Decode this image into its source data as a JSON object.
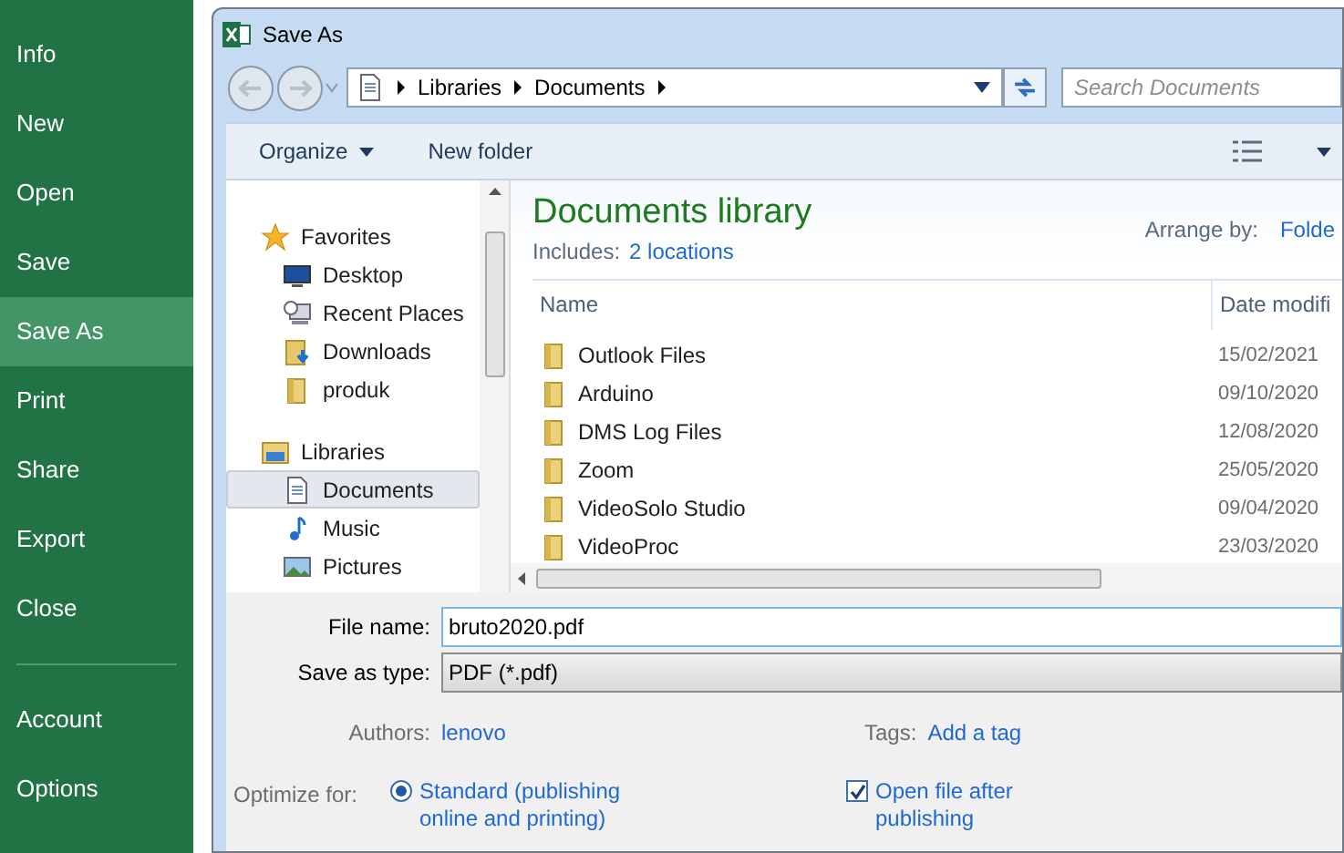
{
  "sidebar": {
    "items": [
      {
        "label": "Info",
        "selected": false
      },
      {
        "label": "New",
        "selected": false
      },
      {
        "label": "Open",
        "selected": false
      },
      {
        "label": "Save",
        "selected": false
      },
      {
        "label": "Save As",
        "selected": true
      },
      {
        "label": "Print",
        "selected": false
      },
      {
        "label": "Share",
        "selected": false
      },
      {
        "label": "Export",
        "selected": false
      },
      {
        "label": "Close",
        "selected": false
      }
    ],
    "footer_items": [
      {
        "label": "Account",
        "selected": false
      },
      {
        "label": "Options",
        "selected": false
      }
    ]
  },
  "dialog": {
    "title": "Save As",
    "breadcrumb": [
      "Libraries",
      "Documents"
    ],
    "search": {
      "placeholder": "Search Documents"
    },
    "toolbar": [
      "Organize",
      "New folder"
    ],
    "nav": [
      {
        "label": "Favorites",
        "kind": "star",
        "selected": false,
        "children": [
          {
            "label": "Desktop",
            "kind": "desktop",
            "selected": false
          },
          {
            "label": "Recent Places",
            "kind": "recent",
            "selected": false
          },
          {
            "label": "Downloads",
            "kind": "downloads",
            "selected": false
          },
          {
            "label": "produk",
            "kind": "folder",
            "selected": false
          }
        ]
      },
      {
        "label": "Libraries",
        "kind": "library",
        "selected": false,
        "children": [
          {
            "label": "Documents",
            "kind": "document",
            "selected": true
          },
          {
            "label": "Music",
            "kind": "music",
            "selected": false
          },
          {
            "label": "Pictures",
            "kind": "picture",
            "selected": false
          }
        ]
      }
    ],
    "library": {
      "title": "Documents library",
      "includes_label": "Includes:",
      "includes_link": "2 locations",
      "arrange_label": "Arrange by:",
      "arrange_value": "Folde"
    },
    "columns": [
      "Name",
      "Date modifi"
    ],
    "rows": [
      {
        "name": "Outlook Files",
        "date": "15/02/2021"
      },
      {
        "name": "Arduino",
        "date": "09/10/2020"
      },
      {
        "name": "DMS Log Files",
        "date": "12/08/2020"
      },
      {
        "name": "Zoom",
        "date": "25/05/2020"
      },
      {
        "name": "VideoSolo Studio",
        "date": "09/04/2020"
      },
      {
        "name": "VideoProc",
        "date": "23/03/2020"
      }
    ],
    "file_name": {
      "label": "File name:",
      "value": "bruto2020.pdf"
    },
    "save_type": {
      "label": "Save as type:",
      "value": "PDF (*.pdf)"
    },
    "authors": {
      "label": "Authors:",
      "value": "lenovo"
    },
    "tags": {
      "label": "Tags:",
      "value": "Add a tag"
    },
    "optimize": {
      "label": "Optimize for:",
      "option": "Standard (publishing online and printing)",
      "selected": true
    },
    "open_after": {
      "label": "Open file after publishing",
      "checked": true
    }
  }
}
